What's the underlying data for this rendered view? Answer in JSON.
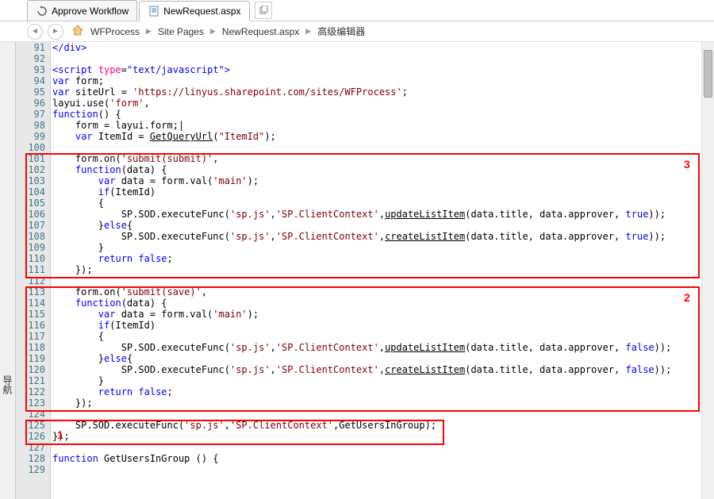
{
  "tabs": {
    "t1": "Approve Workflow",
    "t2": "NewRequest.aspx"
  },
  "crumbs": {
    "c1": "WFProcess",
    "c2": "Site Pages",
    "c3": "NewRequest.aspx",
    "c4": "高级编辑器"
  },
  "sidebar": "导航",
  "annotations": {
    "a1": "1",
    "a2": "2",
    "a3": "3"
  },
  "lines": [
    {
      "n": "91",
      "raw": "</div>",
      "type": "pink"
    },
    {
      "n": "92",
      "raw": ""
    },
    {
      "n": "93",
      "raw": "<script type=\"text/javascript\">",
      "type": "script-tag"
    },
    {
      "n": "94",
      "raw": "var form;",
      "kw": "var"
    },
    {
      "n": "95",
      "raw": "var siteUrl = 'https://linyus.sharepoint.com/sites/WFProcess';",
      "kw": "var",
      "str": "'https://linyus.sharepoint.com/sites/WFProcess'"
    },
    {
      "n": "96",
      "raw": "layui.use('form',",
      "str": "'form'"
    },
    {
      "n": "97",
      "raw": "function() {",
      "kw": "function"
    },
    {
      "n": "98",
      "raw": "    form = layui.form;|"
    },
    {
      "n": "99",
      "raw": "    var ItemId = GetQueryUrl(\"ItemId\");",
      "kw": "var",
      "under": "GetQueryUrl",
      "str": "\"ItemId\""
    },
    {
      "n": "100",
      "raw": ""
    },
    {
      "n": "101",
      "raw": "    form.on('submit(submit)',",
      "str": "'submit(submit)'"
    },
    {
      "n": "102",
      "raw": "    function(data) {",
      "kw": "function"
    },
    {
      "n": "103",
      "raw": "        var data = form.val('main');",
      "kw": "var",
      "str": "'main'"
    },
    {
      "n": "104",
      "raw": "        if(ItemId)",
      "kw": "if"
    },
    {
      "n": "105",
      "raw": "        {"
    },
    {
      "n": "106",
      "raw": "            SP.SOD.executeFunc('sp.js','SP.ClientContext',updateListItem(data.title, data.approver, true));",
      "str1": "'sp.js'",
      "str2": "'SP.ClientContext'",
      "under": "updateListItem",
      "kw": "true"
    },
    {
      "n": "107",
      "raw": "        }else{",
      "kw": "else"
    },
    {
      "n": "108",
      "raw": "            SP.SOD.executeFunc('sp.js','SP.ClientContext',createListItem(data.title, data.approver, true));",
      "str1": "'sp.js'",
      "str2": "'SP.ClientContext'",
      "under": "createListItem",
      "kw": "true"
    },
    {
      "n": "109",
      "raw": "        }"
    },
    {
      "n": "110",
      "raw": "        return false;",
      "kw1": "return",
      "kw2": "false"
    },
    {
      "n": "111",
      "raw": "    });"
    },
    {
      "n": "112",
      "raw": ""
    },
    {
      "n": "113",
      "raw": "    form.on('submit(save)',",
      "str": "'submit(save)'"
    },
    {
      "n": "114",
      "raw": "    function(data) {",
      "kw": "function"
    },
    {
      "n": "115",
      "raw": "        var data = form.val('main');",
      "kw": "var",
      "str": "'main'"
    },
    {
      "n": "116",
      "raw": "        if(ItemId)",
      "kw": "if"
    },
    {
      "n": "117",
      "raw": "        {"
    },
    {
      "n": "118",
      "raw": "            SP.SOD.executeFunc('sp.js','SP.ClientContext',updateListItem(data.title, data.approver, false));",
      "str1": "'sp.js'",
      "str2": "'SP.ClientContext'",
      "under": "updateListItem",
      "kw": "false"
    },
    {
      "n": "119",
      "raw": "        }else{",
      "kw": "else"
    },
    {
      "n": "120",
      "raw": "            SP.SOD.executeFunc('sp.js','SP.ClientContext',createListItem(data.title, data.approver, false));",
      "str1": "'sp.js'",
      "str2": "'SP.ClientContext'",
      "under": "createListItem",
      "kw": "false"
    },
    {
      "n": "121",
      "raw": "        }"
    },
    {
      "n": "122",
      "raw": "        return false;",
      "kw1": "return",
      "kw2": "false"
    },
    {
      "n": "123",
      "raw": "    });"
    },
    {
      "n": "124",
      "raw": ""
    },
    {
      "n": "125",
      "raw": "    SP.SOD.executeFunc('sp.js','SP.ClientContext',GetUsersInGroup);",
      "str1": "'sp.js'",
      "str2": "'SP.ClientContext'"
    },
    {
      "n": "126",
      "raw": "});"
    },
    {
      "n": "127",
      "raw": ""
    },
    {
      "n": "128",
      "raw": "function GetUsersInGroup () {",
      "kw": "function"
    },
    {
      "n": "129",
      "raw": ""
    }
  ]
}
